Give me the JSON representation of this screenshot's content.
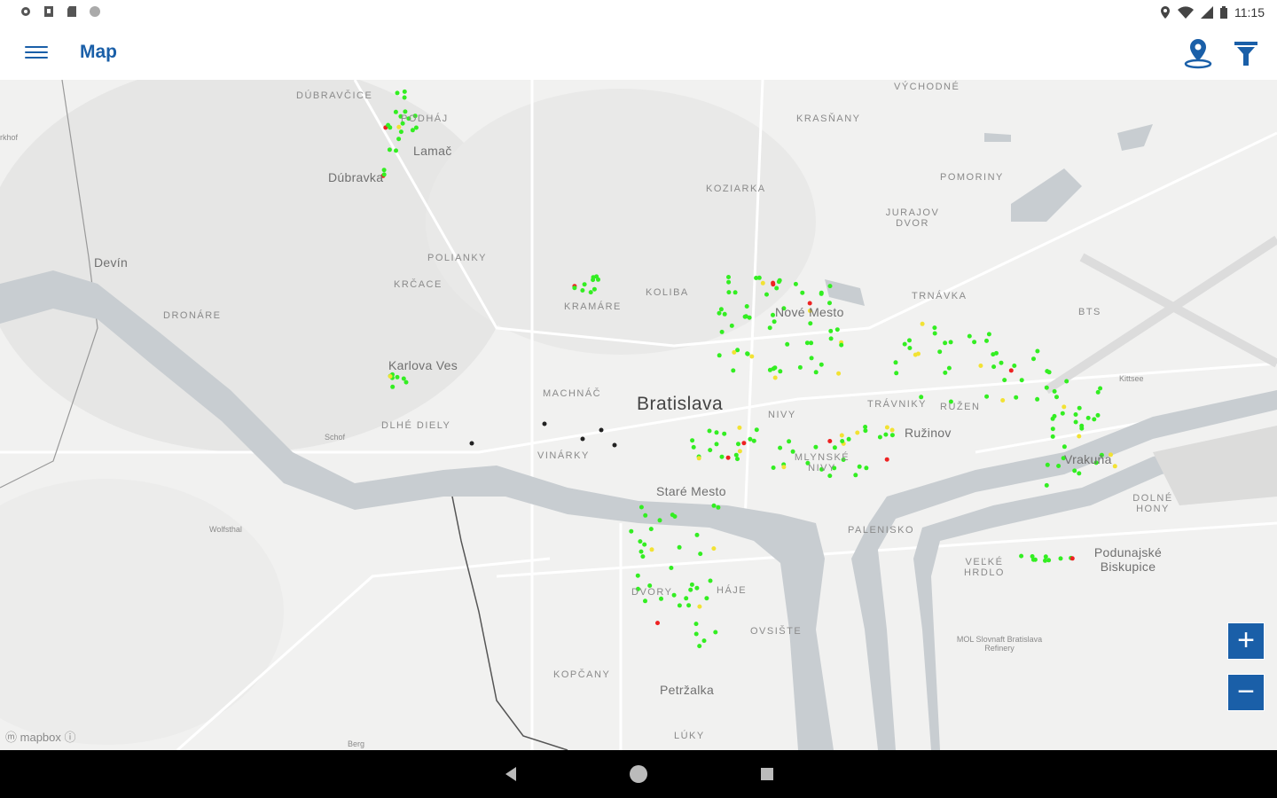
{
  "status_bar": {
    "time": "11:15",
    "left_icons": [
      "settings-icon",
      "sim-icon",
      "sd-card-icon",
      "circle-icon"
    ],
    "right_icons": [
      "location-pin-icon",
      "wifi-icon",
      "signal-icon",
      "battery-icon"
    ]
  },
  "app_bar": {
    "title": "Map",
    "menu_icon": "hamburger-menu-icon",
    "location_icon": "my-location-icon",
    "filter_icon": "filter-icon",
    "accent_color": "#1a5fa8"
  },
  "map": {
    "labels": {
      "dubravcice": "DÚBRAVČICE",
      "podhaj": "PODHÁJ",
      "lamac": "Lamač",
      "dubravka": "Dúbravka",
      "devin": "Devín",
      "polianky": "POLIANKY",
      "kracace": "KRČACE",
      "dronare": "DRONÁRE",
      "karlova_ves": "Karlova Ves",
      "dlhe_diely": "DLHÉ DIELY",
      "machnac": "MACHNÁČ",
      "vinarky": "VINÁRKY",
      "kramare": "KRAMÁRE",
      "koliba": "KOLIBA",
      "koziarka": "KOZIARKA",
      "krasnany": "KRASŇANY",
      "vychodne": "VÝCHODNÉ",
      "pomoriny": "POMORINY",
      "jurajov_dvor": "JURAJOV DVOR",
      "trnavka": "TRNÁVKA",
      "bts": "BTS",
      "nove_mesto": "Nové Mesto",
      "bratislava": "Bratislava",
      "nivy": "NIVY",
      "trnavniky": "TRÁVNIKY",
      "rusen": "RUŽEN",
      "ruzinov": "Ružinov",
      "vrakuna": "Vrakuňa",
      "dolne_hony": "DOLNÉ HONY",
      "mlynske_nivy": "MLYNSKÉ NIVY",
      "stare_mesto": "Staré Mesto",
      "polenisko": "PALENISKO",
      "velke_hrdlo": "VEĽKÉ HRDLO",
      "podunajske": "Podunajské Biskupice",
      "dvory": "DVORY",
      "haje": "HÁJE",
      "ovsiste": "OVSIŠTE",
      "kopcany": "KOPČANY",
      "petrzalka": "Petržalka",
      "luky": "LÚKY",
      "wolfsthal": "Wolfsthal",
      "berg": "Berg",
      "kittsee": "Kittsee",
      "slovnaft": "MOL Slovnaft Bratislava Refinery",
      "hainburg": "rkhof",
      "schoef": "Schof"
    },
    "attribution": "mapbox",
    "marker_colors": {
      "ok": "#33ee22",
      "warn": "#f2e233",
      "bad": "#ee2222",
      "off": "#222222"
    },
    "zoom_in_label": "+",
    "zoom_out_label": "−"
  },
  "nav_bar": {
    "back_icon": "back-triangle-icon",
    "home_icon": "home-circle-icon",
    "recents_icon": "recents-square-icon"
  }
}
